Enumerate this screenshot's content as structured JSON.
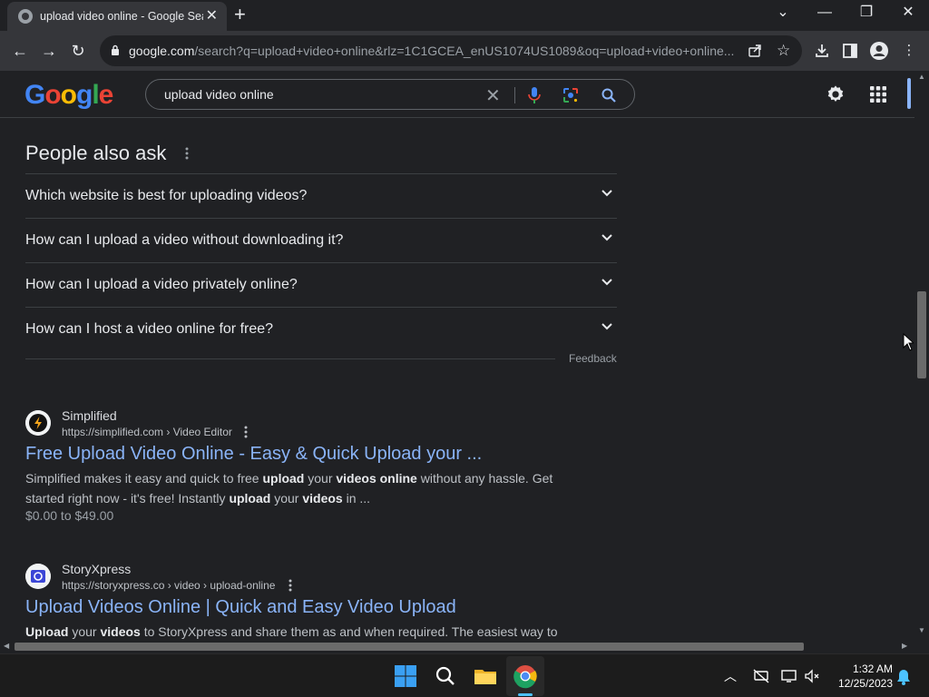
{
  "browser": {
    "tab_title": "upload video online - Google Search",
    "url_host": "google.com",
    "url_rest": "/search?q=upload+video+online&rlz=1C1GCEA_enUS1074US1089&oq=upload+video+online..."
  },
  "google": {
    "logo": "Google",
    "query": "upload video online"
  },
  "paa": {
    "title": "People also ask",
    "questions": [
      "Which website is best for uploading videos?",
      "How can I upload a video without downloading it?",
      "How can I upload a video privately online?",
      "How can I host a video online for free?"
    ],
    "feedback": "Feedback"
  },
  "results": [
    {
      "site": "Simplified",
      "url": "https://simplified.com › Video Editor",
      "title": "Free Upload Video Online - Easy & Quick Upload your ...",
      "snippet_parts": [
        "Simplified makes it easy and quick to free ",
        "upload",
        " your ",
        "videos online",
        " without any hassle. Get started right now - it's free! Instantly ",
        "upload",
        " your ",
        "videos",
        " in ..."
      ],
      "price": "$0.00 to $49.00"
    },
    {
      "site": "StoryXpress",
      "url": "https://storyxpress.co › video › upload-online",
      "title": "Upload Videos Online | Quick and Easy Video Upload",
      "snippet_parts": [
        "Upload",
        " your ",
        "videos",
        " to StoryXpress and share them as and when required. The easiest way to"
      ]
    }
  ],
  "taskbar": {
    "time": "1:32 AM",
    "date": "12/25/2023"
  },
  "colors": {
    "background": "#202124",
    "link": "#8ab4f8",
    "text": "#e8eaed"
  }
}
